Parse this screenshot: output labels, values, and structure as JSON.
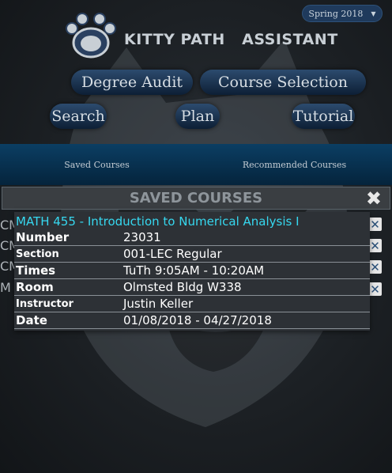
{
  "header": {
    "term_selector": {
      "value": "Spring 2018",
      "icon": "caret-down-icon"
    },
    "app_title": "KITTY PATH   ASSISTANT",
    "logo": "paw-logo"
  },
  "nav": {
    "degree_audit": "Degree Audit",
    "course_selection": "Course Selection",
    "search": "Search",
    "plan": "Plan",
    "tutorial": "Tutorial"
  },
  "tabs": {
    "saved": "Saved Courses",
    "recommended": "Recommended Courses"
  },
  "saved_panel": {
    "title": "SAVED COURSES",
    "close_icon": "close-icon",
    "rows_behind": [
      "CM",
      "CM",
      "CM",
      "M"
    ]
  },
  "course_detail": {
    "title": "MATH 455 - Introduction to Numerical Analysis I",
    "rows": [
      {
        "label": "Number",
        "value": "23031"
      },
      {
        "label": "Section",
        "value": "001-LEC Regular"
      },
      {
        "label": "Times",
        "value": "TuTh 9:05AM - 10:20AM"
      },
      {
        "label": "Room",
        "value": "Olmsted Bldg W338"
      },
      {
        "label": "Instructor",
        "value": "Justin Keller"
      },
      {
        "label": "Date",
        "value": "01/08/2018 - 04/27/2018"
      }
    ]
  },
  "colors": {
    "accent_cyan": "#36d8f0",
    "nav_blue": "#1f3a5c",
    "band_blue": "#0b3e63"
  }
}
